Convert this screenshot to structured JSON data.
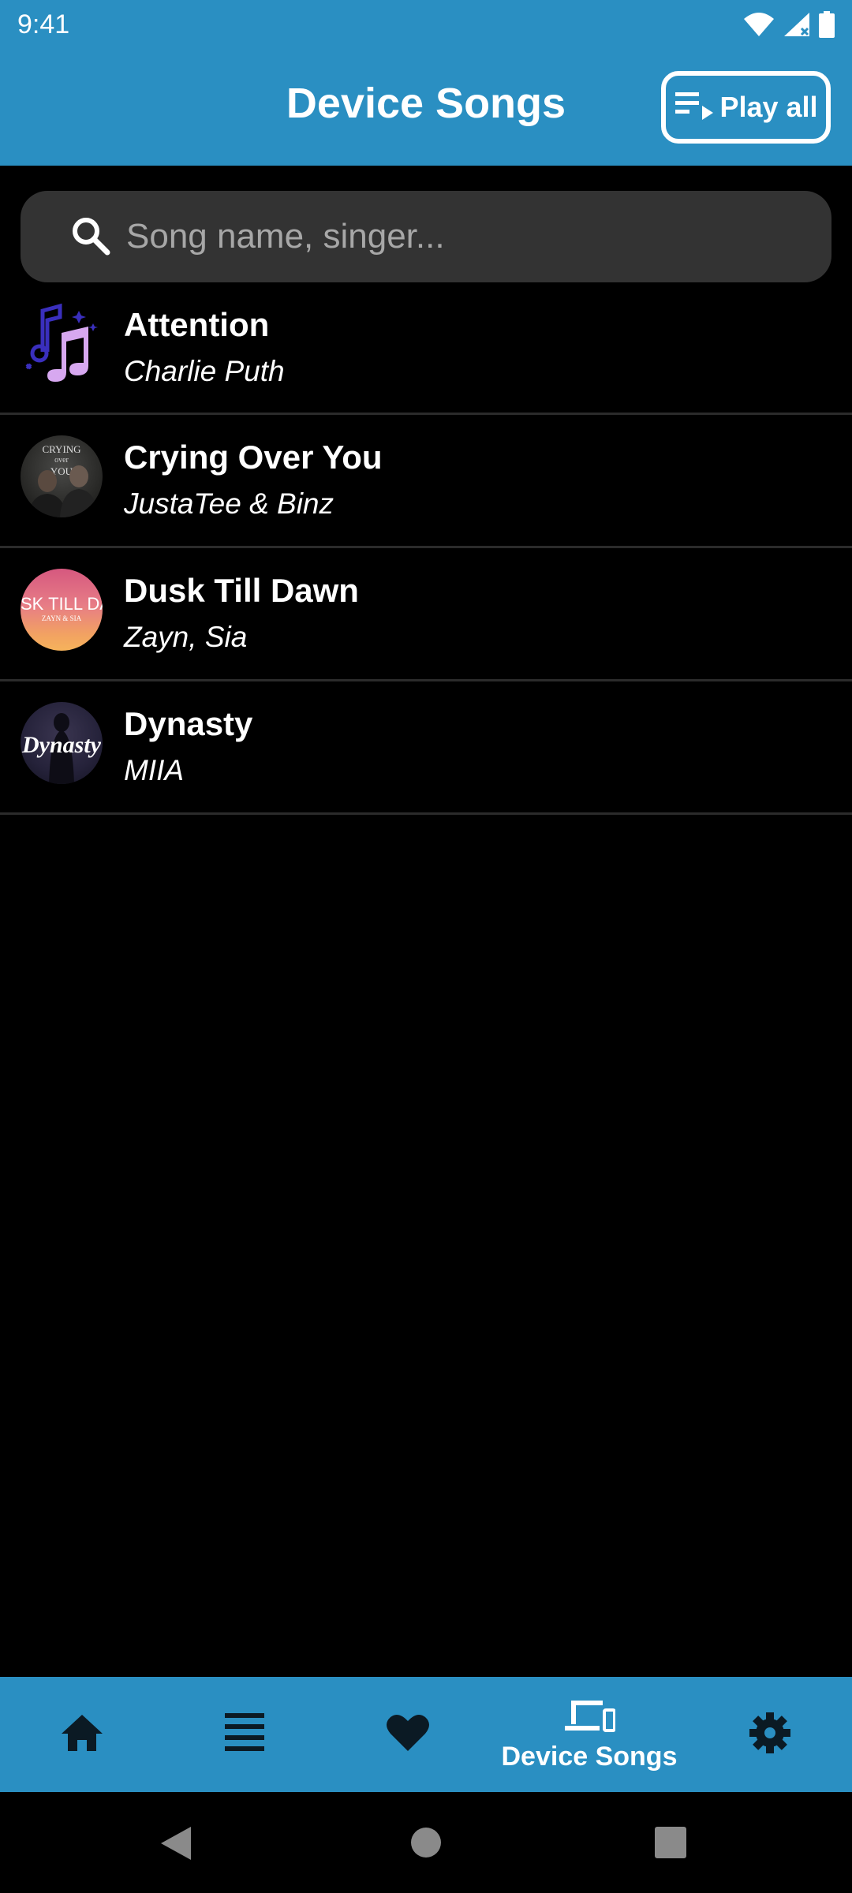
{
  "status_bar": {
    "time": "9:41",
    "icons": [
      "wifi-icon",
      "signal-icon",
      "battery-icon"
    ]
  },
  "app_bar": {
    "title": "Device Songs",
    "play_all_label": "Play all",
    "play_all_icon": "playlist-play-icon"
  },
  "search": {
    "placeholder": "Song name, singer...",
    "value": "",
    "icon": "search-icon"
  },
  "songs": [
    {
      "title": "Attention",
      "artist": "Charlie Puth",
      "thumbnail": "music-note-icon"
    },
    {
      "title": "Crying Over You",
      "artist": "JustaTee & Binz",
      "thumbnail": "album-art",
      "art_text": [
        "CRYING",
        "over",
        "YOU"
      ]
    },
    {
      "title": "Dusk Till Dawn",
      "artist": "Zayn, Sia",
      "thumbnail": "album-art",
      "art_text": [
        "SK TILL DA",
        "ZAYN & SIA"
      ]
    },
    {
      "title": "Dynasty",
      "artist": "MIIA",
      "thumbnail": "album-art",
      "art_text": [
        "Dynasty"
      ]
    }
  ],
  "bottom_nav": {
    "items": [
      {
        "name": "home",
        "icon": "home-icon",
        "label": ""
      },
      {
        "name": "list",
        "icon": "list-icon",
        "label": ""
      },
      {
        "name": "favorites",
        "icon": "heart-icon",
        "label": ""
      },
      {
        "name": "device-songs",
        "icon": "devices-icon",
        "label": "Device Songs",
        "active": true
      },
      {
        "name": "settings",
        "icon": "gear-icon",
        "label": ""
      }
    ]
  },
  "system_nav": [
    "back-icon",
    "home-circle-icon",
    "recents-icon"
  ],
  "colors": {
    "primary": "#2a8fc2",
    "background": "#000000",
    "search_bg": "#333333",
    "divider": "#2b2b2b",
    "text": "#ffffff",
    "placeholder": "#a7a7a7"
  }
}
